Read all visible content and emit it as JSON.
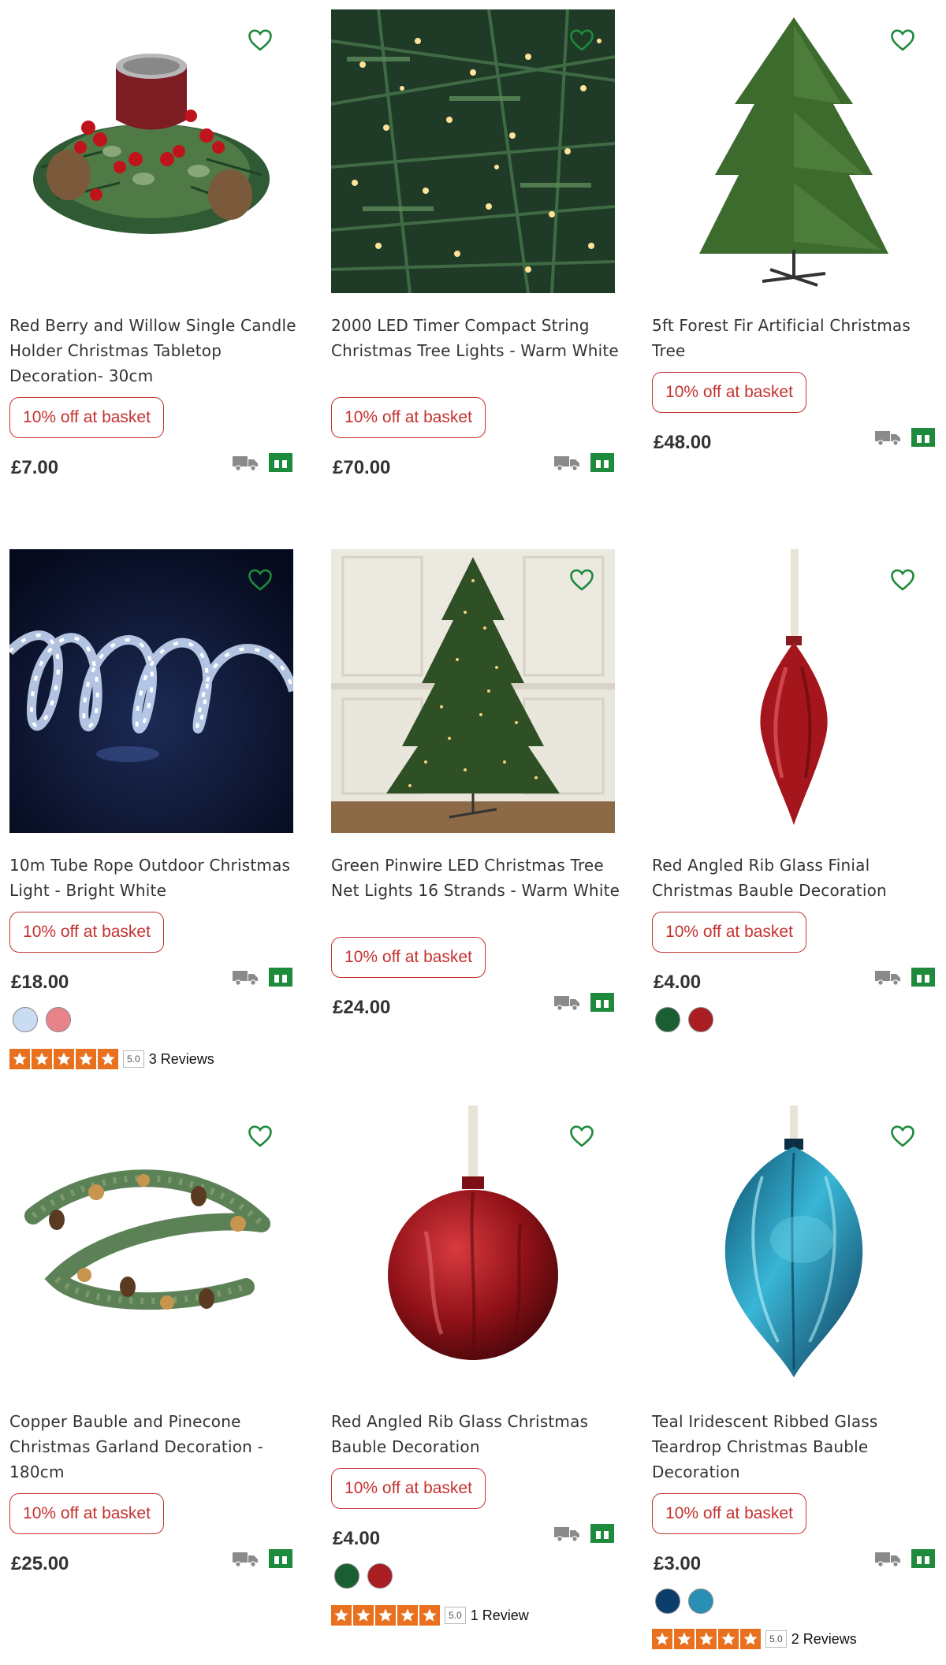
{
  "colors": {
    "accent_green": "#1e8a3c",
    "promo_red": "#c4322f",
    "star_orange": "#e8701e"
  },
  "products": [
    {
      "title": "Red Berry and Willow Single Candle Holder Christmas Tabletop Decoration- 30cm",
      "promo": "10% off at basket",
      "price": "£7.00",
      "image": "candle-holder-image"
    },
    {
      "title": "2000 LED Timer Compact String Christmas Tree Lights - Warm White",
      "promo": "10% off at basket",
      "price": "£70.00",
      "image": "string-lights-image"
    },
    {
      "title": "5ft Forest Fir Artificial Christmas Tree",
      "promo": "10% off at basket",
      "price": "£48.00",
      "image": "fir-tree-image"
    },
    {
      "title": "10m Tube Rope Outdoor Christmas Light - Bright White",
      "promo": "10% off at basket",
      "price": "£18.00",
      "image": "rope-light-image",
      "swatches": [
        "#c9dcf2",
        "#e8838b"
      ],
      "rating": {
        "score": "5.0",
        "reviews": "3 Reviews",
        "stars": 5
      }
    },
    {
      "title": "Green Pinwire LED Christmas Tree Net Lights 16 Strands - Warm White",
      "promo": "10% off at basket",
      "price": "£24.00",
      "image": "net-lights-tree-image"
    },
    {
      "title": "Red Angled Rib Glass Finial Christmas Bauble Decoration",
      "promo": "10% off at basket",
      "price": "£4.00",
      "image": "finial-bauble-image",
      "swatches": [
        "#1c5e34",
        "#a81e22"
      ]
    },
    {
      "title": "Copper Bauble and Pinecone Christmas Garland Decoration - 180cm",
      "promo": "10% off at basket",
      "price": "£25.00",
      "image": "garland-image"
    },
    {
      "title": "Red Angled Rib Glass Christmas Bauble Decoration",
      "promo": "10% off at basket",
      "price": "£4.00",
      "image": "red-bauble-image",
      "swatches": [
        "#1c5e34",
        "#a81e22"
      ],
      "rating": {
        "score": "5.0",
        "reviews": "1 Review",
        "stars": 5
      }
    },
    {
      "title": "Teal Iridescent Ribbed Glass Teardrop Christmas Bauble Decoration",
      "promo": "10% off at basket",
      "price": "£3.00",
      "image": "teal-bauble-image",
      "swatches": [
        "#0d3d6b",
        "#2a8fb5"
      ],
      "rating": {
        "score": "5.0",
        "reviews": "2 Reviews",
        "stars": 5
      }
    }
  ]
}
